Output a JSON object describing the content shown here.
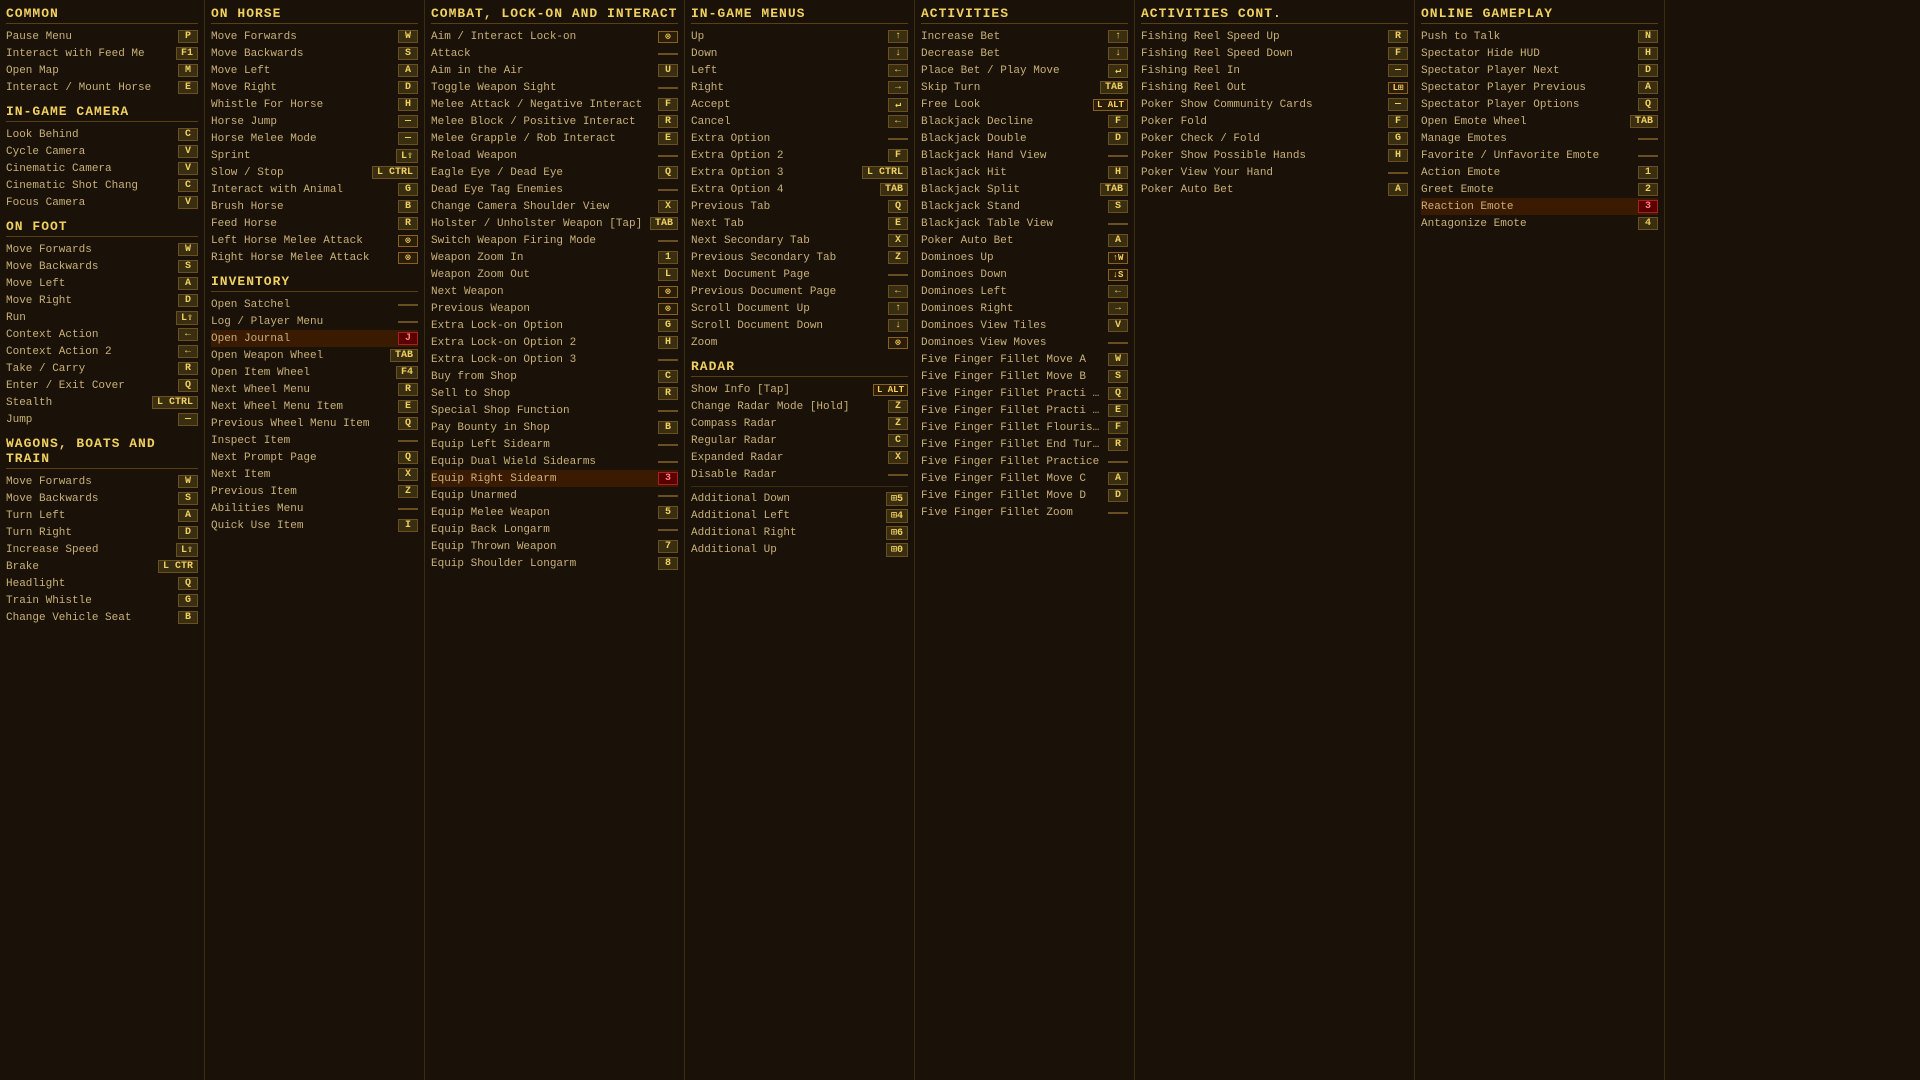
{
  "col1": {
    "sections": [
      {
        "header": "Common",
        "items": [
          {
            "label": "Pause Menu",
            "key": "P"
          },
          {
            "label": "Interact with Feed Me",
            "key": "F1"
          },
          {
            "label": "Open Map",
            "key": "M"
          },
          {
            "label": "Interact / Mount Horse",
            "key": "E"
          }
        ]
      },
      {
        "header": "In-Game Camera",
        "items": [
          {
            "label": "Look Behind",
            "key": "C"
          },
          {
            "label": "Cycle Camera",
            "key": "V"
          },
          {
            "label": "Cinematic Camera",
            "key": "V"
          },
          {
            "label": "Cinematic Shot Chang",
            "key": "C"
          },
          {
            "label": "Focus Camera",
            "key": "V"
          }
        ]
      },
      {
        "header": "On Foot",
        "items": [
          {
            "label": "Move Forwards",
            "key": "W"
          },
          {
            "label": "Move Backwards",
            "key": "S"
          },
          {
            "label": "Move Left",
            "key": "A"
          },
          {
            "label": "Move Right",
            "key": "D"
          },
          {
            "label": "Run",
            "key": "L⇧"
          },
          {
            "label": "Context Action",
            "key": "←"
          },
          {
            "label": "Context Action 2",
            "key": "←"
          },
          {
            "label": "Take / Carry",
            "key": "R"
          },
          {
            "label": "Enter / Exit Cover",
            "key": "Q"
          },
          {
            "label": "Stealth",
            "key": "L CTRL"
          },
          {
            "label": "Jump",
            "key": "—"
          }
        ]
      },
      {
        "header": "Wagons, Boats and Train",
        "items": [
          {
            "label": "Move Forwards",
            "key": "W"
          },
          {
            "label": "Move Backwards",
            "key": "S"
          },
          {
            "label": "Turn Left",
            "key": "A"
          },
          {
            "label": "Turn Right",
            "key": "D"
          },
          {
            "label": "Increase Speed",
            "key": "L⇧"
          },
          {
            "label": "Brake",
            "key": "L CTR"
          },
          {
            "label": "Headlight",
            "key": "Q"
          },
          {
            "label": "Train Whistle",
            "key": "G"
          },
          {
            "label": "Change Vehicle Seat",
            "key": "B"
          }
        ]
      }
    ]
  },
  "col2": {
    "sections": [
      {
        "header": "On Horse",
        "items": [
          {
            "label": "Move Forwards",
            "key": "W"
          },
          {
            "label": "Move Backwards",
            "key": "S"
          },
          {
            "label": "Move Left",
            "key": "A"
          },
          {
            "label": "Move Right",
            "key": "D"
          },
          {
            "label": "Whistle For Horse",
            "key": "H"
          },
          {
            "label": "Horse Jump",
            "key": "—"
          },
          {
            "label": "Horse Melee Mode",
            "key": "—"
          },
          {
            "label": "Sprint",
            "key": "L⇧"
          },
          {
            "label": "Slow / Stop",
            "key": "L CTRL"
          },
          {
            "label": "Interact with Animal",
            "key": "G"
          },
          {
            "label": "Brush Horse",
            "key": "B"
          },
          {
            "label": "Feed Horse",
            "key": "R"
          },
          {
            "label": "Left Horse Melee Attack",
            "key": "⊙"
          },
          {
            "label": "Right Horse Melee Attack",
            "key": "⊙"
          }
        ]
      },
      {
        "header": "Inventory",
        "items": [
          {
            "label": "Open Satchel",
            "key": ""
          },
          {
            "label": "Log / Player Menu",
            "key": ""
          },
          {
            "label": "Open Journal",
            "key": "J",
            "highlight": true
          },
          {
            "label": "Open Weapon Wheel",
            "key": "TAB"
          },
          {
            "label": "Open Item Wheel",
            "key": "F4"
          },
          {
            "label": "Next Wheel Menu",
            "key": "R"
          },
          {
            "label": "Next Wheel Menu Item",
            "key": "E"
          },
          {
            "label": "Previous Wheel Menu Item",
            "key": "Q"
          },
          {
            "label": "Inspect Item",
            "key": ""
          },
          {
            "label": "Next Prompt Page",
            "key": "Q"
          },
          {
            "label": "Next Item",
            "key": "X"
          },
          {
            "label": "Previous Item",
            "key": "Z"
          },
          {
            "label": "Abilities Menu",
            "key": ""
          },
          {
            "label": "Quick Use Item",
            "key": "I"
          }
        ]
      }
    ]
  },
  "col3": {
    "header": "Combat, Lock-On and Interact",
    "items": [
      {
        "label": "Aim / Interact Lock-on",
        "key": "⊙"
      },
      {
        "label": "Attack",
        "key": ""
      },
      {
        "label": "Aim in the Air",
        "key": "U"
      },
      {
        "label": "Toggle Weapon Sight",
        "key": ""
      },
      {
        "label": "Melee Attack / Negative Interact",
        "key": "F"
      },
      {
        "label": "Melee Block / Positive Interact",
        "key": "R"
      },
      {
        "label": "Melee Grapple / Rob Interact",
        "key": "E"
      },
      {
        "label": "Reload Weapon",
        "key": ""
      },
      {
        "label": "Eagle Eye / Dead Eye",
        "key": "Q"
      },
      {
        "label": "Dead Eye Tag Enemies",
        "key": ""
      },
      {
        "label": "Change Camera Shoulder View",
        "key": "X"
      },
      {
        "label": "Holster / Unholster Weapon [Tap]",
        "key": "TAB"
      },
      {
        "label": "Switch Weapon Firing Mode",
        "key": ""
      },
      {
        "label": "Weapon Zoom In",
        "key": "1"
      },
      {
        "label": "Weapon Zoom Out",
        "key": "L"
      },
      {
        "label": "Next Weapon",
        "key": "⊙"
      },
      {
        "label": "Previous Weapon",
        "key": "⊙"
      },
      {
        "label": "Extra Lock-on Option",
        "key": "G"
      },
      {
        "label": "Extra Lock-on Option 2",
        "key": "H"
      },
      {
        "label": "Extra Lock-on Option 3",
        "key": ""
      },
      {
        "label": "Buy from Shop",
        "key": "C"
      },
      {
        "label": "Sell to Shop",
        "key": "R"
      },
      {
        "label": "Special Shop Function",
        "key": ""
      },
      {
        "label": "Pay Bounty in Shop",
        "key": "B"
      },
      {
        "label": "Equip Left Sidearm",
        "key": ""
      },
      {
        "label": "Equip Dual Wield Sidearms",
        "key": ""
      },
      {
        "label": "Equip Right Sidearm",
        "key": "3",
        "highlight": true
      },
      {
        "label": "Equip Unarmed",
        "key": ""
      },
      {
        "label": "Equip Melee Weapon",
        "key": "5"
      },
      {
        "label": "Equip Back Longarm",
        "key": ""
      },
      {
        "label": "Equip Thrown Weapon",
        "key": "7"
      },
      {
        "label": "Equip Shoulder Longarm",
        "key": "8"
      }
    ]
  },
  "col4": {
    "sections": [
      {
        "header": "In-Game Menus",
        "items": [
          {
            "label": "Up",
            "key": "↑"
          },
          {
            "label": "Down",
            "key": "↓"
          },
          {
            "label": "Left",
            "key": "←"
          },
          {
            "label": "Right",
            "key": "→"
          },
          {
            "label": "Accept",
            "key": "↵"
          },
          {
            "label": "Cancel",
            "key": "←"
          },
          {
            "label": "Extra Option",
            "key": ""
          },
          {
            "label": "Extra Option 2",
            "key": "F"
          },
          {
            "label": "Extra Option 3",
            "key": "L CTRL"
          },
          {
            "label": "Extra Option 4",
            "key": "TAB"
          },
          {
            "label": "Previous Tab",
            "key": "Q"
          },
          {
            "label": "Next Tab",
            "key": "E"
          },
          {
            "label": "Next Secondary Tab",
            "key": "X"
          },
          {
            "label": "Previous Secondary Tab",
            "key": "Z"
          },
          {
            "label": "Next Document Page",
            "key": ""
          },
          {
            "label": "Previous Document Page",
            "key": "←"
          },
          {
            "label": "Scroll Document Up",
            "key": "↑"
          },
          {
            "label": "Scroll Document Down",
            "key": "↓"
          },
          {
            "label": "Zoom",
            "key": "⊙"
          }
        ]
      },
      {
        "header": "Radar",
        "items": [
          {
            "label": "Show Info [Tap]",
            "key": "L ALT"
          },
          {
            "label": "Change Radar Mode [Hold]",
            "key": "Z"
          },
          {
            "label": "Compass Radar",
            "key": "Z"
          },
          {
            "label": "Regular Radar",
            "key": "C"
          },
          {
            "label": "Expanded Radar",
            "key": "X"
          },
          {
            "label": "Disable Radar",
            "key": ""
          }
        ]
      },
      {
        "header": "Additional",
        "items": [
          {
            "label": "Additional Down",
            "key": "⊞5"
          },
          {
            "label": "Additional Left",
            "key": "⊞4"
          },
          {
            "label": "Additional Right",
            "key": "⊞6"
          },
          {
            "label": "Additional Up",
            "key": "⊞0"
          }
        ]
      }
    ]
  },
  "col5": {
    "header": "Activities",
    "items": [
      {
        "label": "Increase Bet",
        "key": "↑"
      },
      {
        "label": "Decrease Bet",
        "key": "↓"
      },
      {
        "label": "Place Bet / Play Move",
        "key": "↵"
      },
      {
        "label": "Skip Turn",
        "key": "TAB"
      },
      {
        "label": "Free Look",
        "key": "L ALT"
      },
      {
        "label": "Blackjack Decline",
        "key": "F"
      },
      {
        "label": "Blackjack Double",
        "key": "D"
      },
      {
        "label": "Blackjack Hand View",
        "key": ""
      },
      {
        "label": "Blackjack Hit",
        "key": "H"
      },
      {
        "label": "Blackjack Split",
        "key": "TAB"
      },
      {
        "label": "Blackjack Stand",
        "key": "S"
      },
      {
        "label": "Blackjack Table View",
        "key": ""
      },
      {
        "label": "Poker Auto Bet",
        "key": "A"
      },
      {
        "label": "Dominoes Up",
        "key": "↑W"
      },
      {
        "label": "Dominoes Down",
        "key": "↓S"
      },
      {
        "label": "Dominoes Left",
        "key": "←"
      },
      {
        "label": "Dominoes Right",
        "key": "→"
      },
      {
        "label": "Dominoes View Tiles",
        "key": "V"
      },
      {
        "label": "Dominoes View Moves",
        "key": ""
      },
      {
        "label": "Five Finger Fillet Move A",
        "key": "W"
      },
      {
        "label": "Five Finger Fillet Move B",
        "key": "S"
      },
      {
        "label": "Five Finger Fillet Practi Left",
        "key": "Q"
      },
      {
        "label": "Five Finger Fillet Practi Right",
        "key": "E"
      },
      {
        "label": "Five Finger Fillet Flourish & Co",
        "key": "F"
      },
      {
        "label": "Five Finger Fillet End Turn/At",
        "key": "R"
      },
      {
        "label": "Five Finger Fillet Practice",
        "key": ""
      },
      {
        "label": "Five Finger Fillet Move C",
        "key": "A"
      },
      {
        "label": "Five Finger Fillet Move D",
        "key": "D"
      },
      {
        "label": "Five Finger Fillet Zoom",
        "key": ""
      }
    ]
  },
  "col6": {
    "header": "Activities cont.",
    "items": [
      {
        "label": "Fishing Reel Speed Up",
        "key": "R"
      },
      {
        "label": "Fishing Reel Speed Down",
        "key": "F"
      },
      {
        "label": "Fishing Reel In",
        "key": "—"
      },
      {
        "label": "Fishing Reel Out",
        "key": "L⊞"
      },
      {
        "label": "Poker Show Community Cards",
        "key": "—"
      },
      {
        "label": "Poker Fold",
        "key": "F"
      },
      {
        "label": "Poker Check / Fold",
        "key": "G"
      },
      {
        "label": "Poker Show Possible Hands",
        "key": "H"
      },
      {
        "label": "Poker View Your Hand",
        "key": ""
      },
      {
        "label": "Poker Auto Bet",
        "key": "A"
      }
    ]
  },
  "col7": {
    "sections": [
      {
        "header": "Online Gameplay",
        "items": [
          {
            "label": "Push to Talk",
            "key": "N"
          },
          {
            "label": "Spectator Hide HUD",
            "key": "H"
          },
          {
            "label": "Spectator Player Next",
            "key": "D"
          },
          {
            "label": "Spectator Player Previous",
            "key": "A"
          },
          {
            "label": "Spectator Player Options",
            "key": "Q"
          },
          {
            "label": "Open Emote Wheel",
            "key": "TAB"
          },
          {
            "label": "Manage Emotes",
            "key": ""
          },
          {
            "label": "Favorite / Unfavorite Emote",
            "key": ""
          },
          {
            "label": "Action Emote",
            "key": "1"
          },
          {
            "label": "Greet Emote",
            "key": "2"
          },
          {
            "label": "Reaction Emote",
            "key": "3",
            "highlight": true
          },
          {
            "label": "Antagonize Emote",
            "key": "4"
          }
        ]
      }
    ]
  }
}
